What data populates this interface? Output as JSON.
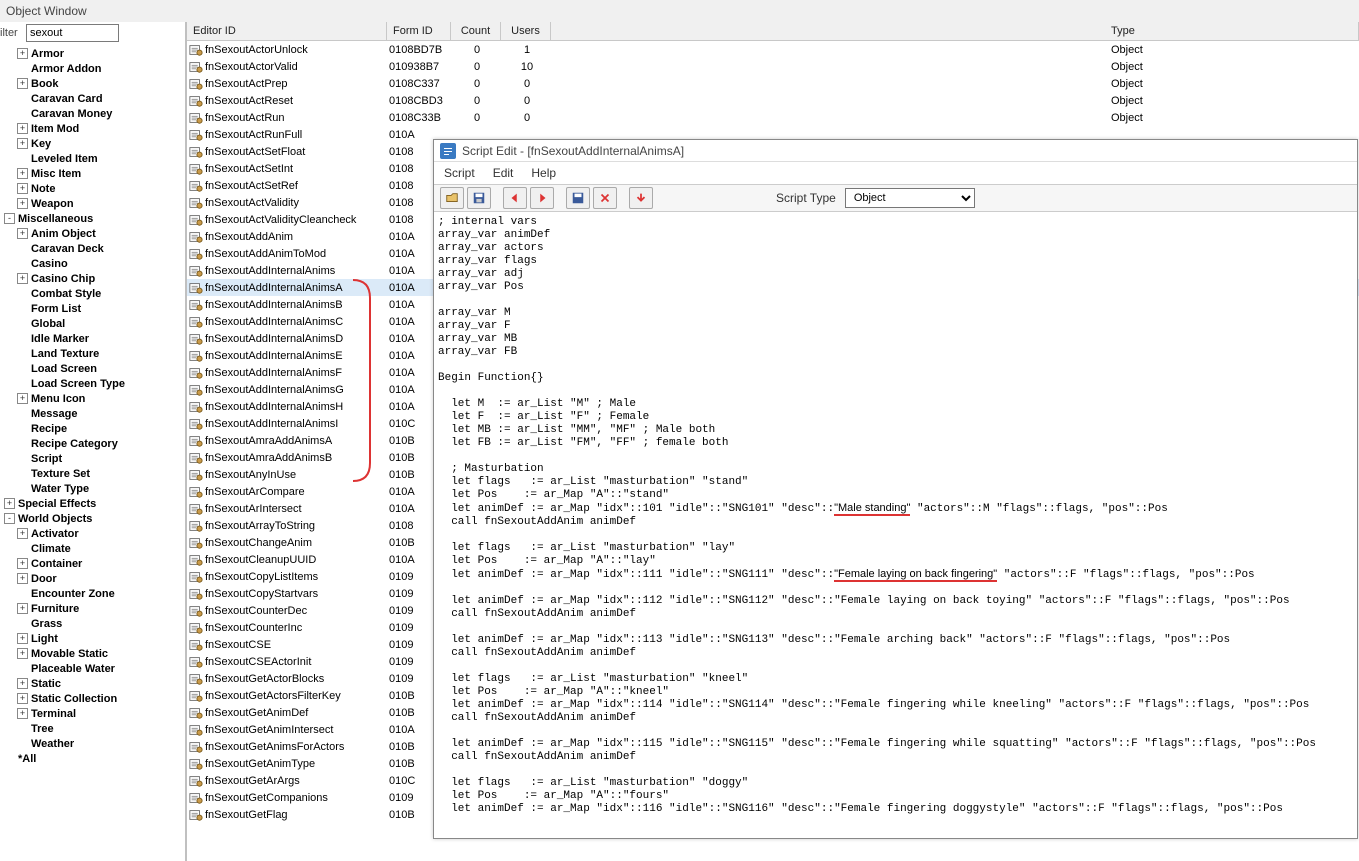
{
  "window_title": "Object Window",
  "filter": {
    "label": "ilter",
    "value": "sexout"
  },
  "tree": [
    {
      "ind": 1,
      "toggle": "+",
      "label": "Armor"
    },
    {
      "ind": 1,
      "toggle": "",
      "label": "Armor Addon"
    },
    {
      "ind": 1,
      "toggle": "+",
      "label": "Book"
    },
    {
      "ind": 1,
      "toggle": "",
      "label": "Caravan Card"
    },
    {
      "ind": 1,
      "toggle": "",
      "label": "Caravan Money"
    },
    {
      "ind": 1,
      "toggle": "+",
      "label": "Item Mod"
    },
    {
      "ind": 1,
      "toggle": "+",
      "label": "Key"
    },
    {
      "ind": 1,
      "toggle": "",
      "label": "Leveled Item"
    },
    {
      "ind": 1,
      "toggle": "+",
      "label": "Misc Item"
    },
    {
      "ind": 1,
      "toggle": "+",
      "label": "Note"
    },
    {
      "ind": 1,
      "toggle": "+",
      "label": "Weapon"
    },
    {
      "ind": 0,
      "toggle": "-",
      "label": "Miscellaneous"
    },
    {
      "ind": 1,
      "toggle": "+",
      "label": "Anim Object"
    },
    {
      "ind": 1,
      "toggle": "",
      "label": "Caravan Deck"
    },
    {
      "ind": 1,
      "toggle": "",
      "label": "Casino"
    },
    {
      "ind": 1,
      "toggle": "+",
      "label": "Casino Chip"
    },
    {
      "ind": 1,
      "toggle": "",
      "label": "Combat Style"
    },
    {
      "ind": 1,
      "toggle": "",
      "label": "Form List"
    },
    {
      "ind": 1,
      "toggle": "",
      "label": "Global"
    },
    {
      "ind": 1,
      "toggle": "",
      "label": "Idle Marker"
    },
    {
      "ind": 1,
      "toggle": "",
      "label": "Land Texture"
    },
    {
      "ind": 1,
      "toggle": "",
      "label": "Load Screen"
    },
    {
      "ind": 1,
      "toggle": "",
      "label": "Load Screen Type"
    },
    {
      "ind": 1,
      "toggle": "+",
      "label": "Menu Icon"
    },
    {
      "ind": 1,
      "toggle": "",
      "label": "Message"
    },
    {
      "ind": 1,
      "toggle": "",
      "label": "Recipe"
    },
    {
      "ind": 1,
      "toggle": "",
      "label": "Recipe Category"
    },
    {
      "ind": 1,
      "toggle": "",
      "label": "Script"
    },
    {
      "ind": 1,
      "toggle": "",
      "label": "Texture Set"
    },
    {
      "ind": 1,
      "toggle": "",
      "label": "Water Type"
    },
    {
      "ind": 0,
      "toggle": "+",
      "label": "Special Effects"
    },
    {
      "ind": 0,
      "toggle": "-",
      "label": "World Objects"
    },
    {
      "ind": 1,
      "toggle": "+",
      "label": "Activator"
    },
    {
      "ind": 1,
      "toggle": "",
      "label": "Climate"
    },
    {
      "ind": 1,
      "toggle": "+",
      "label": "Container"
    },
    {
      "ind": 1,
      "toggle": "+",
      "label": "Door"
    },
    {
      "ind": 1,
      "toggle": "",
      "label": "Encounter Zone"
    },
    {
      "ind": 1,
      "toggle": "+",
      "label": "Furniture"
    },
    {
      "ind": 1,
      "toggle": "",
      "label": "Grass"
    },
    {
      "ind": 1,
      "toggle": "+",
      "label": "Light"
    },
    {
      "ind": 1,
      "toggle": "+",
      "label": "Movable Static"
    },
    {
      "ind": 1,
      "toggle": "",
      "label": "Placeable Water"
    },
    {
      "ind": 1,
      "toggle": "+",
      "label": "Static"
    },
    {
      "ind": 1,
      "toggle": "+",
      "label": "Static Collection"
    },
    {
      "ind": 1,
      "toggle": "+",
      "label": "Terminal"
    },
    {
      "ind": 1,
      "toggle": "",
      "label": "Tree"
    },
    {
      "ind": 1,
      "toggle": "",
      "label": "Weather"
    },
    {
      "ind": 0,
      "toggle": "",
      "label": "*All"
    }
  ],
  "grid": {
    "headers": {
      "editor": "Editor ID",
      "form": "Form ID",
      "count": "Count",
      "users": "Users",
      "type": "Type"
    },
    "rows": [
      {
        "editor": "fnSexoutActorUnlock",
        "form": "0108BD7B",
        "count": "0",
        "users": "1",
        "type": "Object"
      },
      {
        "editor": "fnSexoutActorValid",
        "form": "010938B7",
        "count": "0",
        "users": "10",
        "type": "Object"
      },
      {
        "editor": "fnSexoutActPrep",
        "form": "0108C337",
        "count": "0",
        "users": "0",
        "type": "Object"
      },
      {
        "editor": "fnSexoutActReset",
        "form": "0108CBD3",
        "count": "0",
        "users": "0",
        "type": "Object"
      },
      {
        "editor": "fnSexoutActRun",
        "form": "0108C33B",
        "count": "0",
        "users": "0",
        "type": "Object"
      },
      {
        "editor": "fnSexoutActRunFull",
        "form": "010A",
        "count": "",
        "users": "",
        "type": ""
      },
      {
        "editor": "fnSexoutActSetFloat",
        "form": "0108",
        "count": "",
        "users": "",
        "type": ""
      },
      {
        "editor": "fnSexoutActSetInt",
        "form": "0108",
        "count": "",
        "users": "",
        "type": ""
      },
      {
        "editor": "fnSexoutActSetRef",
        "form": "0108",
        "count": "",
        "users": "",
        "type": ""
      },
      {
        "editor": "fnSexoutActValidity",
        "form": "0108",
        "count": "",
        "users": "",
        "type": ""
      },
      {
        "editor": "fnSexoutActValidityCleancheck",
        "form": "0108",
        "count": "",
        "users": "",
        "type": ""
      },
      {
        "editor": "fnSexoutAddAnim",
        "form": "010A",
        "count": "",
        "users": "",
        "type": ""
      },
      {
        "editor": "fnSexoutAddAnimToMod",
        "form": "010A",
        "count": "",
        "users": "",
        "type": ""
      },
      {
        "editor": "fnSexoutAddInternalAnims",
        "form": "010A",
        "count": "",
        "users": "",
        "type": ""
      },
      {
        "editor": "fnSexoutAddInternalAnimsA",
        "form": "010A",
        "count": "",
        "users": "",
        "type": "",
        "sel": true
      },
      {
        "editor": "fnSexoutAddInternalAnimsB",
        "form": "010A",
        "count": "",
        "users": "",
        "type": ""
      },
      {
        "editor": "fnSexoutAddInternalAnimsC",
        "form": "010A",
        "count": "",
        "users": "",
        "type": ""
      },
      {
        "editor": "fnSexoutAddInternalAnimsD",
        "form": "010A",
        "count": "",
        "users": "",
        "type": ""
      },
      {
        "editor": "fnSexoutAddInternalAnimsE",
        "form": "010A",
        "count": "",
        "users": "",
        "type": ""
      },
      {
        "editor": "fnSexoutAddInternalAnimsF",
        "form": "010A",
        "count": "",
        "users": "",
        "type": ""
      },
      {
        "editor": "fnSexoutAddInternalAnimsG",
        "form": "010A",
        "count": "",
        "users": "",
        "type": ""
      },
      {
        "editor": "fnSexoutAddInternalAnimsH",
        "form": "010A",
        "count": "",
        "users": "",
        "type": ""
      },
      {
        "editor": "fnSexoutAddInternalAnimsI",
        "form": "010C",
        "count": "",
        "users": "",
        "type": ""
      },
      {
        "editor": "fnSexoutAmraAddAnimsA",
        "form": "010B",
        "count": "",
        "users": "",
        "type": ""
      },
      {
        "editor": "fnSexoutAmraAddAnimsB",
        "form": "010B",
        "count": "",
        "users": "",
        "type": ""
      },
      {
        "editor": "fnSexoutAnyInUse",
        "form": "010B",
        "count": "",
        "users": "",
        "type": ""
      },
      {
        "editor": "fnSexoutArCompare",
        "form": "010A",
        "count": "",
        "users": "",
        "type": ""
      },
      {
        "editor": "fnSexoutArIntersect",
        "form": "010A",
        "count": "",
        "users": "",
        "type": ""
      },
      {
        "editor": "fnSexoutArrayToString",
        "form": "0108",
        "count": "",
        "users": "",
        "type": ""
      },
      {
        "editor": "fnSexoutChangeAnim",
        "form": "010B",
        "count": "",
        "users": "",
        "type": ""
      },
      {
        "editor": "fnSexoutCleanupUUID",
        "form": "010A",
        "count": "",
        "users": "",
        "type": ""
      },
      {
        "editor": "fnSexoutCopyListItems",
        "form": "0109",
        "count": "",
        "users": "",
        "type": ""
      },
      {
        "editor": "fnSexoutCopyStartvars",
        "form": "0109",
        "count": "",
        "users": "",
        "type": ""
      },
      {
        "editor": "fnSexoutCounterDec",
        "form": "0109",
        "count": "",
        "users": "",
        "type": ""
      },
      {
        "editor": "fnSexoutCounterInc",
        "form": "0109",
        "count": "",
        "users": "",
        "type": ""
      },
      {
        "editor": "fnSexoutCSE",
        "form": "0109",
        "count": "",
        "users": "",
        "type": ""
      },
      {
        "editor": "fnSexoutCSEActorInit",
        "form": "0109",
        "count": "",
        "users": "",
        "type": ""
      },
      {
        "editor": "fnSexoutGetActorBlocks",
        "form": "0109",
        "count": "",
        "users": "",
        "type": ""
      },
      {
        "editor": "fnSexoutGetActorsFilterKey",
        "form": "010B",
        "count": "",
        "users": "",
        "type": ""
      },
      {
        "editor": "fnSexoutGetAnimDef",
        "form": "010B",
        "count": "",
        "users": "",
        "type": ""
      },
      {
        "editor": "fnSexoutGetAnimIntersect",
        "form": "010A",
        "count": "",
        "users": "",
        "type": ""
      },
      {
        "editor": "fnSexoutGetAnimsForActors",
        "form": "010B",
        "count": "",
        "users": "",
        "type": ""
      },
      {
        "editor": "fnSexoutGetAnimType",
        "form": "010B",
        "count": "",
        "users": "",
        "type": ""
      },
      {
        "editor": "fnSexoutGetArArgs",
        "form": "010C",
        "count": "",
        "users": "",
        "type": ""
      },
      {
        "editor": "fnSexoutGetCompanions",
        "form": "0109",
        "count": "",
        "users": "",
        "type": ""
      },
      {
        "editor": "fnSexoutGetFlag",
        "form": "010B",
        "count": "",
        "users": "",
        "type": ""
      }
    ]
  },
  "script_win": {
    "title": "Script Edit - [fnSexoutAddInternalAnimsA]",
    "menu": [
      "Script",
      "Edit",
      "Help"
    ],
    "type_label": "Script Type",
    "type_value": "Object",
    "code": "; internal vars\narray_var animDef\narray_var actors\narray_var flags\narray_var adj\narray_var Pos\n\narray_var M\narray_var F\narray_var MB\narray_var FB\n\nBegin Function{}\n\n  let M  := ar_List \"M\" ; Male\n  let F  := ar_List \"F\" ; Female\n  let MB := ar_List \"MM\", \"MF\" ; Male both\n  let FB := ar_List \"FM\", \"FF\" ; female both\n\n  ; Masturbation\n  let flags   := ar_List \"masturbation\" \"stand\"\n  let Pos    := ar_Map \"A\"::\"stand\"\n  let animDef := ar_Map \"idx\"::101 \"idle\"::\"SNG101\" \"desc\"::%%U1_S%%\"Male standing\"%%U1_E%% \"actors\"::M \"flags\"::flags, \"pos\"::Pos\n  call fnSexoutAddAnim animDef\n\n  let flags   := ar_List \"masturbation\" \"lay\"\n  let Pos    := ar_Map \"A\"::\"lay\"\n  let animDef := ar_Map \"idx\"::111 \"idle\"::\"SNG111\" \"desc\"::%%U2_S%%\"Female laying on back fingering\"%%U2_E%% \"actors\"::F \"flags\"::flags, \"pos\"::Pos\n\n  let animDef := ar_Map \"idx\"::112 \"idle\"::\"SNG112\" \"desc\"::\"Female laying on back toying\" \"actors\"::F \"flags\"::flags, \"pos\"::Pos\n  call fnSexoutAddAnim animDef\n\n  let animDef := ar_Map \"idx\"::113 \"idle\"::\"SNG113\" \"desc\"::\"Female arching back\" \"actors\"::F \"flags\"::flags, \"pos\"::Pos\n  call fnSexoutAddAnim animDef\n\n  let flags   := ar_List \"masturbation\" \"kneel\"\n  let Pos    := ar_Map \"A\"::\"kneel\"\n  let animDef := ar_Map \"idx\"::114 \"idle\"::\"SNG114\" \"desc\"::\"Female fingering while kneeling\" \"actors\"::F \"flags\"::flags, \"pos\"::Pos\n  call fnSexoutAddAnim animDef\n\n  let animDef := ar_Map \"idx\"::115 \"idle\"::\"SNG115\" \"desc\"::\"Female fingering while squatting\" \"actors\"::F \"flags\"::flags, \"pos\"::Pos\n  call fnSexoutAddAnim animDef\n\n  let flags   := ar_List \"masturbation\" \"doggy\"\n  let Pos    := ar_Map \"A\"::\"fours\"\n  let animDef := ar_Map \"idx\"::116 \"idle\"::\"SNG116\" \"desc\"::\"Female fingering doggystyle\" \"actors\"::F \"flags\"::flags, \"pos\"::Pos"
  }
}
